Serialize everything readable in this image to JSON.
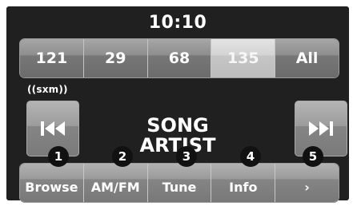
{
  "clock": "10:10",
  "presets": [
    "121",
    "29",
    "68",
    "135",
    "All"
  ],
  "active_preset": "135",
  "brand": "((sxm))",
  "seek_back_icon": "seek-back-icon",
  "seek_forward_icon": "seek-forward-icon",
  "now_playing": {
    "song": "SONG",
    "artist": "ARTIST"
  },
  "bottom_buttons": [
    "Browse",
    "AM/FM",
    "Tune",
    "Info",
    "›"
  ],
  "callouts": [
    "1",
    "2",
    "3",
    "4",
    "5"
  ],
  "colors": {
    "screen_bg": "#202020",
    "button": "#8e8e8e",
    "active_preset": "#d4d4d4",
    "text": "#ffffff"
  }
}
